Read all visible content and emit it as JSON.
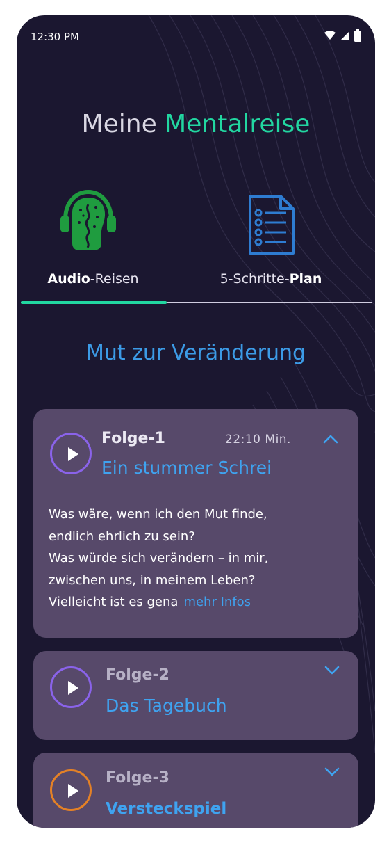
{
  "status": {
    "time": "12:30 PM"
  },
  "header": {
    "title_part1": "Meine ",
    "title_accent": "Mentalreise"
  },
  "tabs": [
    {
      "bold": "Audio",
      "rest": "-Reisen",
      "icon": "head-headphones-icon",
      "active": true
    },
    {
      "prefix": "5-Schritte-",
      "bold": "Plan",
      "icon": "checklist-document-icon",
      "active": false
    }
  ],
  "section": {
    "title": "Mut zur Veränderung"
  },
  "episodes": [
    {
      "label": "Folge-1",
      "title": "Ein stummer Schrei",
      "duration": "22:10 Min.",
      "expanded": true,
      "description_lines": [
        "Was wäre, wenn ich den Mut finde,",
        "endlich ehrlich zu sein?",
        "Was würde sich verändern – in mir,",
        "zwischen uns, in meinem Leben?",
        "Vielleicht ist es gena"
      ],
      "more_link": "mehr Infos"
    },
    {
      "label": "Folge-2",
      "title": "Das Tagebuch",
      "expanded": false
    },
    {
      "label": "Folge-3",
      "title": "Versteckspiel",
      "expanded": false
    }
  ],
  "colors": {
    "accent": "#22d7a1",
    "link": "#3fa3f0",
    "background": "#1b1730",
    "card": "#57496a"
  }
}
